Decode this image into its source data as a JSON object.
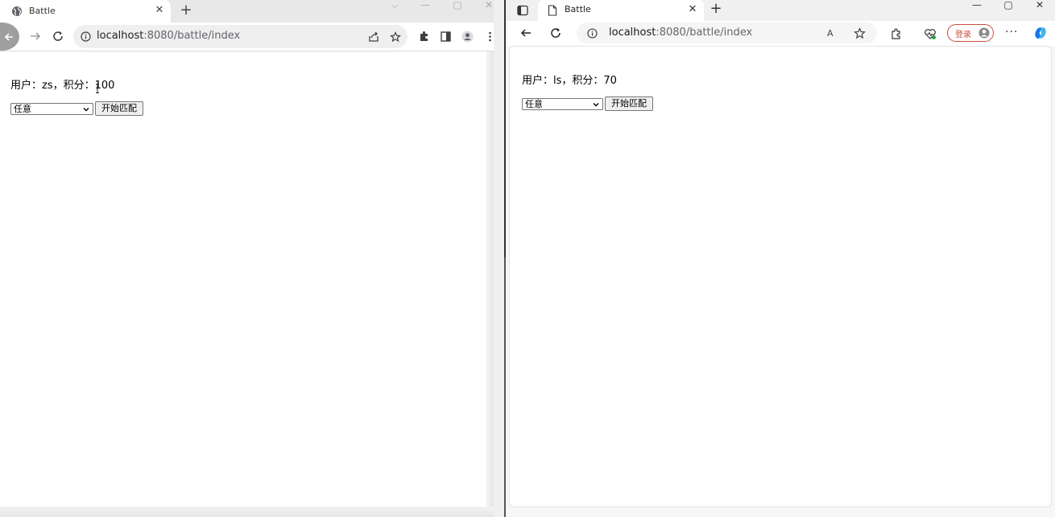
{
  "left_browser": {
    "tab": {
      "title": "Battle"
    },
    "toolbar": {
      "url_host": "localhost",
      "url_path": ":8080/battle/index"
    },
    "page": {
      "user_line": "用户：zs，积分：100",
      "select_value": "任意",
      "match_button": "开始匹配"
    }
  },
  "right_browser": {
    "tab": {
      "title": "Battle"
    },
    "toolbar": {
      "url_host": "localhost",
      "url_path": ":8080/battle/index",
      "read_aloud": "A",
      "login_label": "登录"
    },
    "page": {
      "user_line": "用户：ls，积分：70",
      "select_value": "任意",
      "match_button": "开始匹配"
    }
  },
  "icons": {
    "globe": "globe-icon",
    "document": "document-icon",
    "back": "arrow-left-icon",
    "forward": "arrow-right-icon",
    "reload": "reload-icon",
    "info": "info-icon",
    "share": "share-icon",
    "star": "star-icon",
    "extensions": "puzzle-icon",
    "sidepanel": "side-panel-icon",
    "profile": "profile-icon",
    "menu": "kebab-menu-icon"
  },
  "colors": {
    "login_accent": "#c94c3d",
    "copilot": "#1a73e8"
  }
}
